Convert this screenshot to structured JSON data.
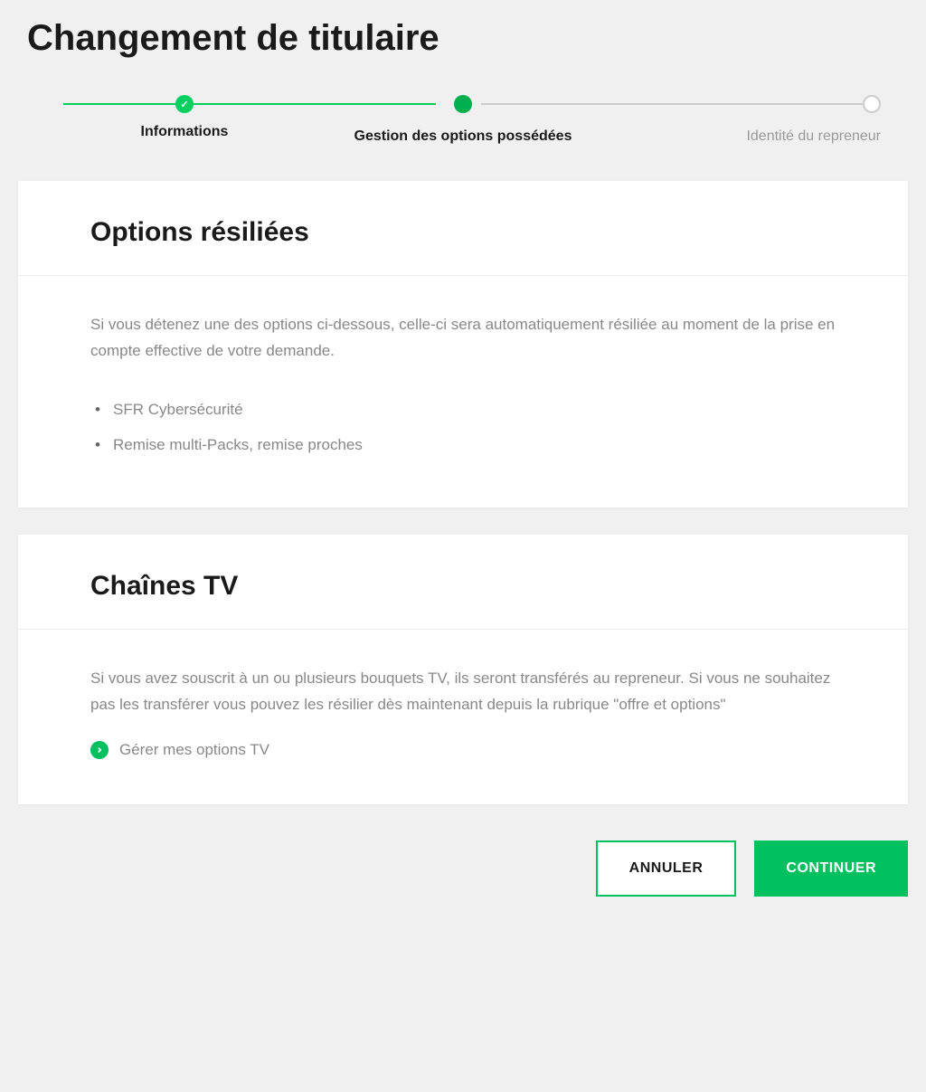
{
  "page": {
    "title": "Changement de titulaire"
  },
  "stepper": {
    "steps": [
      {
        "label": "Informations"
      },
      {
        "label": "Gestion des options possédées"
      },
      {
        "label": "Identité du repreneur"
      }
    ]
  },
  "cards": {
    "options_resiliees": {
      "title": "Options résiliées",
      "description": "Si vous détenez une des options ci-dessous, celle-ci sera automatiquement résiliée au moment de la prise en compte effective de votre demande.",
      "items": [
        "SFR Cybersécurité",
        "Remise multi-Packs, remise proches"
      ]
    },
    "chaines_tv": {
      "title": "Chaînes TV",
      "description": "Si vous avez souscrit à un ou plusieurs bouquets TV, ils seront transférés au repreneur. Si vous ne souhaitez pas les transférer vous pouvez les résilier dès maintenant depuis la rubrique \"offre et options\"",
      "link_label": "Gérer mes options TV"
    }
  },
  "actions": {
    "cancel": "ANNULER",
    "continue": "CONTINUER"
  }
}
